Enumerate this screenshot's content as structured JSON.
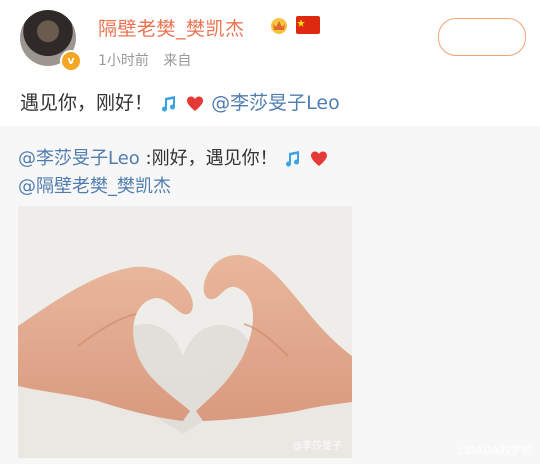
{
  "post": {
    "username": "隔壁老樊_樊凯杰",
    "time": "1小时前",
    "source": "来自",
    "text_main": "遇见你，刚好！",
    "mention": "@李莎旻子Leo"
  },
  "repost": {
    "author": "@李莎旻子Leo",
    "text": " :刚好，遇见你！",
    "mention_line": "@隔壁老樊_樊凯杰",
    "photo_watermark": "@李莎旻子"
  },
  "page_watermark": "LIDADA的梦想",
  "colors": {
    "username": "#eb7350",
    "link": "#507daf",
    "repost_bg": "#f7f7f7"
  },
  "icons": [
    "crown-icon",
    "flag-icon",
    "music-note-icon",
    "heart-icon"
  ]
}
